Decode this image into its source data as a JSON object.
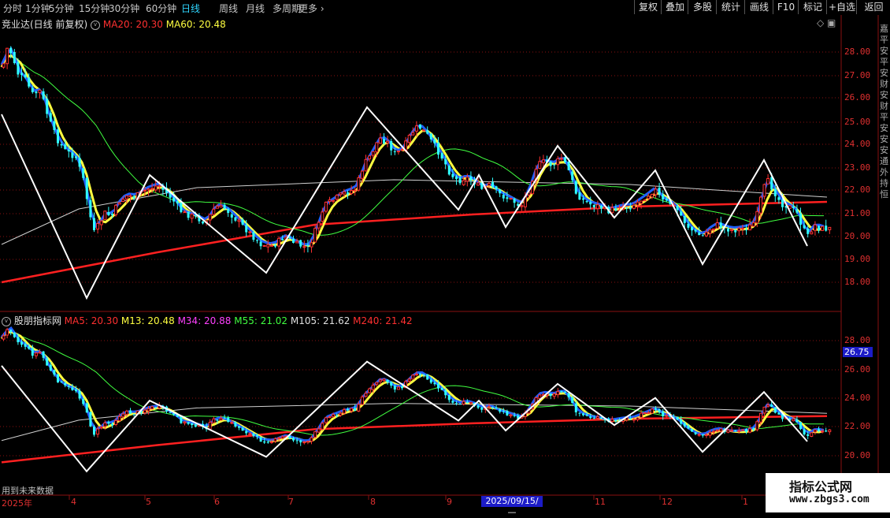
{
  "toolbar": {
    "periods": [
      "分时",
      "1分钟",
      "5分钟",
      "15分钟",
      "30分钟",
      "60分钟",
      "日线",
      "周线",
      "月线",
      "多周期",
      "更多"
    ],
    "active_period": "日线",
    "buttons": [
      "复权",
      "叠加",
      "多股",
      "统计",
      "画线",
      "F10",
      "标记",
      "+自选",
      "返回"
    ]
  },
  "upper_panel": {
    "title": "竞业达(日线 前复权)",
    "ma20": "MA20: 20.30",
    "ma60": "MA60: 20.48",
    "y_labels": [
      "28.00",
      "27.00",
      "26.00",
      "25.00",
      "24.00",
      "23.00",
      "22.00",
      "21.00",
      "20.00",
      "19.00",
      "18.00"
    ]
  },
  "lower_panel": {
    "title": "股朋指标网",
    "ma_items": [
      {
        "label": "MA5: 20.30",
        "color": "#ff3030"
      },
      {
        "label": "M13: 20.48",
        "color": "#ffff40"
      },
      {
        "label": "M34: 20.88",
        "color": "#ff40ff"
      },
      {
        "label": "M55: 21.02",
        "color": "#40ff40"
      },
      {
        "label": "M105: 21.62",
        "color": "#e0e0e0"
      },
      {
        "label": "M240: 21.42",
        "color": "#ff3030"
      }
    ],
    "y_labels": [
      "28.00",
      "26.00",
      "24.00",
      "22.00",
      "20.00"
    ],
    "price_tag": "26.75",
    "future_label": "用到未来数据"
  },
  "x_axis": {
    "labels": [
      "2025年",
      "4",
      "5",
      "6",
      "7",
      "8",
      "9",
      "11",
      "12",
      "1"
    ],
    "cursor_date": "2025/09/15/—"
  },
  "watermark": {
    "title": "指标公式网",
    "url": "www.zbgs3.com"
  },
  "colors": {
    "up": "#ff3030",
    "down": "#30ffff",
    "grid": "#8a1010",
    "ma20": "#ff3030",
    "ma60": "#ffff40",
    "zigzag": "#ffffff"
  }
}
